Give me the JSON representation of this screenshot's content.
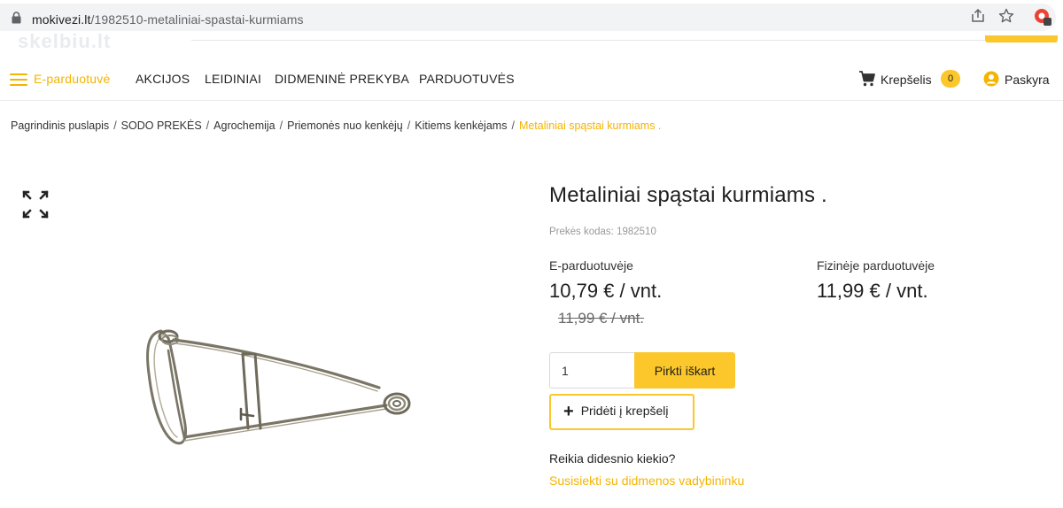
{
  "browser": {
    "url_host": "mokivezi.lt",
    "url_path": "/1982510-metaliniai-spastai-kurmiams",
    "icons": [
      "lock-icon",
      "share-icon",
      "star-icon",
      "extension-icon"
    ]
  },
  "site": {
    "ghost_logo": "skelbiu.lt"
  },
  "nav": {
    "items": [
      "E-parduotuvė",
      "AKCIJOS",
      "LEIDINIAI",
      "DIDMENINĖ PREKYBA",
      "PARDUOTUVĖS"
    ],
    "cart_label": "Krepšelis",
    "cart_count": "0",
    "account_label": "Paskyra",
    "accent": "#fbc72a"
  },
  "breadcrumb": [
    "Pagrindinis puslapis",
    "SODO PREKĖS",
    "Agrochemija",
    "Priemonės nuo kenkėjų",
    "Kitiems kenkėjams",
    "Metaliniai spąstai kurmiams ."
  ],
  "product": {
    "title": "Metaliniai spąstai kurmiams .",
    "code": "Prekės kodas: 1982510",
    "eshop_label": "E-parduotuvėje",
    "eshop_price": "10,79 € / vnt.",
    "eshop_old_price": "11,99 € / vnt.",
    "store_label": "Fizinėje parduotuvėje",
    "store_price": "11,99 € / vnt.",
    "quantity": "1",
    "buy_now": "Pirkti iškart",
    "add_to_cart": "Pridėti į krepšelį",
    "bulk_question": "Reikia didesnio kiekio?",
    "bulk_contact": "Susisiekti su didmenos vadybininku"
  }
}
